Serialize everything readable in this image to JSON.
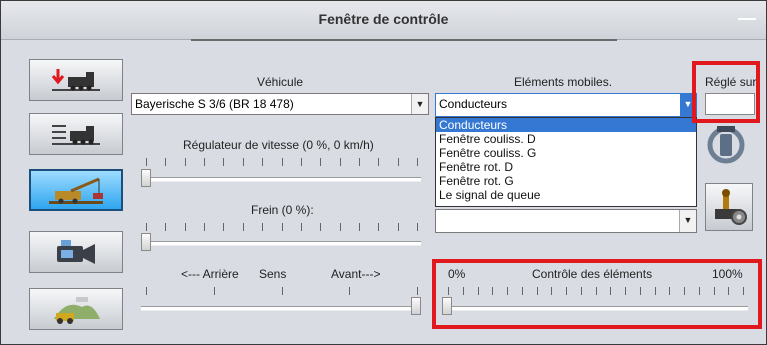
{
  "window": {
    "title": "Fenêtre de contrôle",
    "minimize_label": "—"
  },
  "vehicle": {
    "label": "Véhicule",
    "selected": "Bayerische S 3/6 (BR 18 478)"
  },
  "speed": {
    "label": "Régulateur de vitesse (0 %, 0 km/h)",
    "level": 0
  },
  "brake": {
    "label": "Frein (0 %):",
    "level": 0
  },
  "direction": {
    "back_label": "<--- Arrière",
    "sens_label": "Sens",
    "forward_label": "Avant--->",
    "level": 1
  },
  "moving_elements": {
    "label": "Eléments mobiles.",
    "selected": "Conducteurs",
    "options": [
      "Conducteurs",
      "Fenêtre couliss. D",
      "Fenêtre couliss. G",
      "Fenêtre rot. D",
      "Fenêtre rot. G",
      "Le signal de queue"
    ],
    "second_combo_value": ""
  },
  "set_to": {
    "label": "Réglé sur",
    "value": ""
  },
  "element_control": {
    "min_label": "0%",
    "label": "Contrôle des éléments",
    "max_label": "100%",
    "level": 0
  },
  "colors": {
    "highlight": "#e0191e",
    "active_button": "#2ea5ee",
    "selection": "#3478d4"
  },
  "sidebar_icons": [
    "train-delete-icon",
    "train-list-icon",
    "crane-icon",
    "camera-icon",
    "scenery-icon"
  ],
  "right_icons": [
    "rotate-camera-icon",
    "element-settings-icon"
  ]
}
